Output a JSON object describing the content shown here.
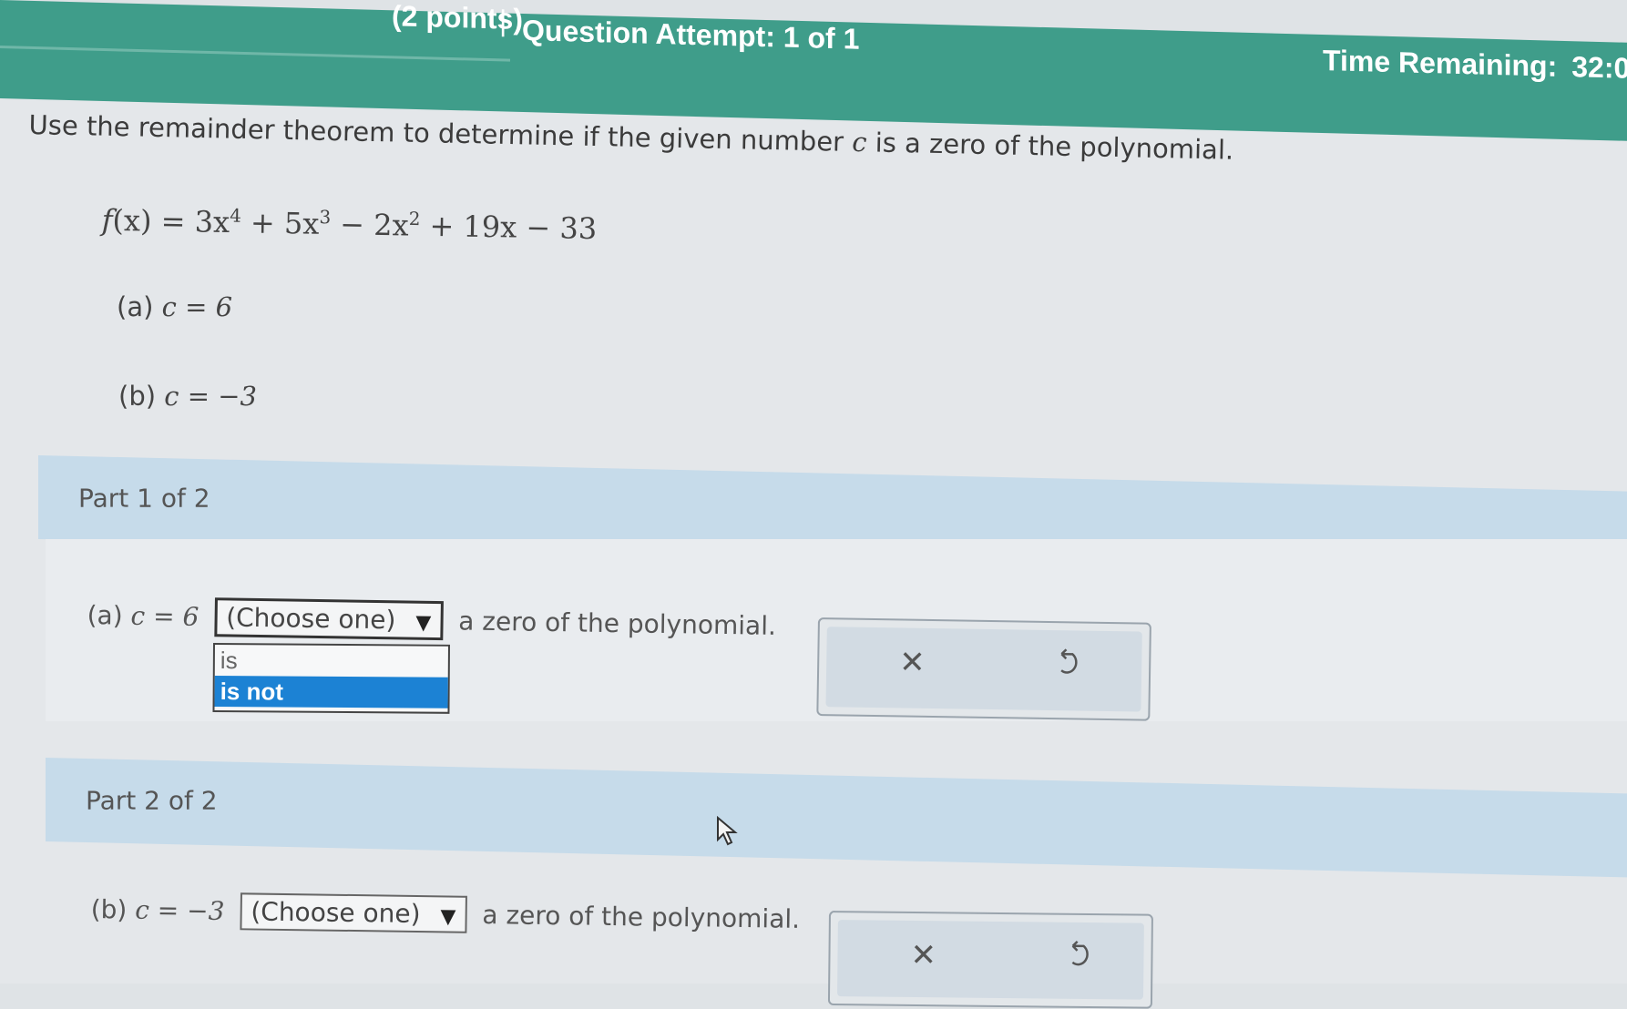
{
  "header": {
    "points": "(2 points)",
    "separator": "|",
    "attempt": "Question Attempt: 1 of 1",
    "time_label": "Time Remaining:",
    "time_value": "32:0"
  },
  "question": {
    "prompt_start": "Use the remainder theorem to determine if the given number",
    "prompt_var": "c",
    "prompt_end": "is a zero of the polynomial.",
    "formula_f": "f",
    "formula_parts": [
      "(x) = 3x",
      "4",
      " + 5x",
      "3",
      " − 2x",
      "2",
      " + 19x − 33"
    ],
    "item_a": "(a)",
    "item_a_math": "c = 6",
    "item_b": "(b)",
    "item_b_math": "c = −3"
  },
  "part1": {
    "title": "Part 1 of 2",
    "label": "(a)",
    "math": "c = 6",
    "select_value": "(Choose one)",
    "suffix": "a zero of the polynomial.",
    "options": [
      "is",
      "is not"
    ],
    "highlighted_option": "is not"
  },
  "part2": {
    "title": "Part 2 of 2",
    "label": "(b)",
    "math": "c = −3",
    "select_value": "(Choose one)",
    "suffix": "a zero of the polynomial."
  },
  "icons": {
    "clear": "close-icon",
    "undo": "undo-icon",
    "dropdown": "chevron-down-icon",
    "cursor": "mouse-pointer-icon"
  },
  "colors": {
    "header": "#3f9d8a",
    "part_header": "#c6dbea",
    "option_highlight": "#1c82d4"
  }
}
